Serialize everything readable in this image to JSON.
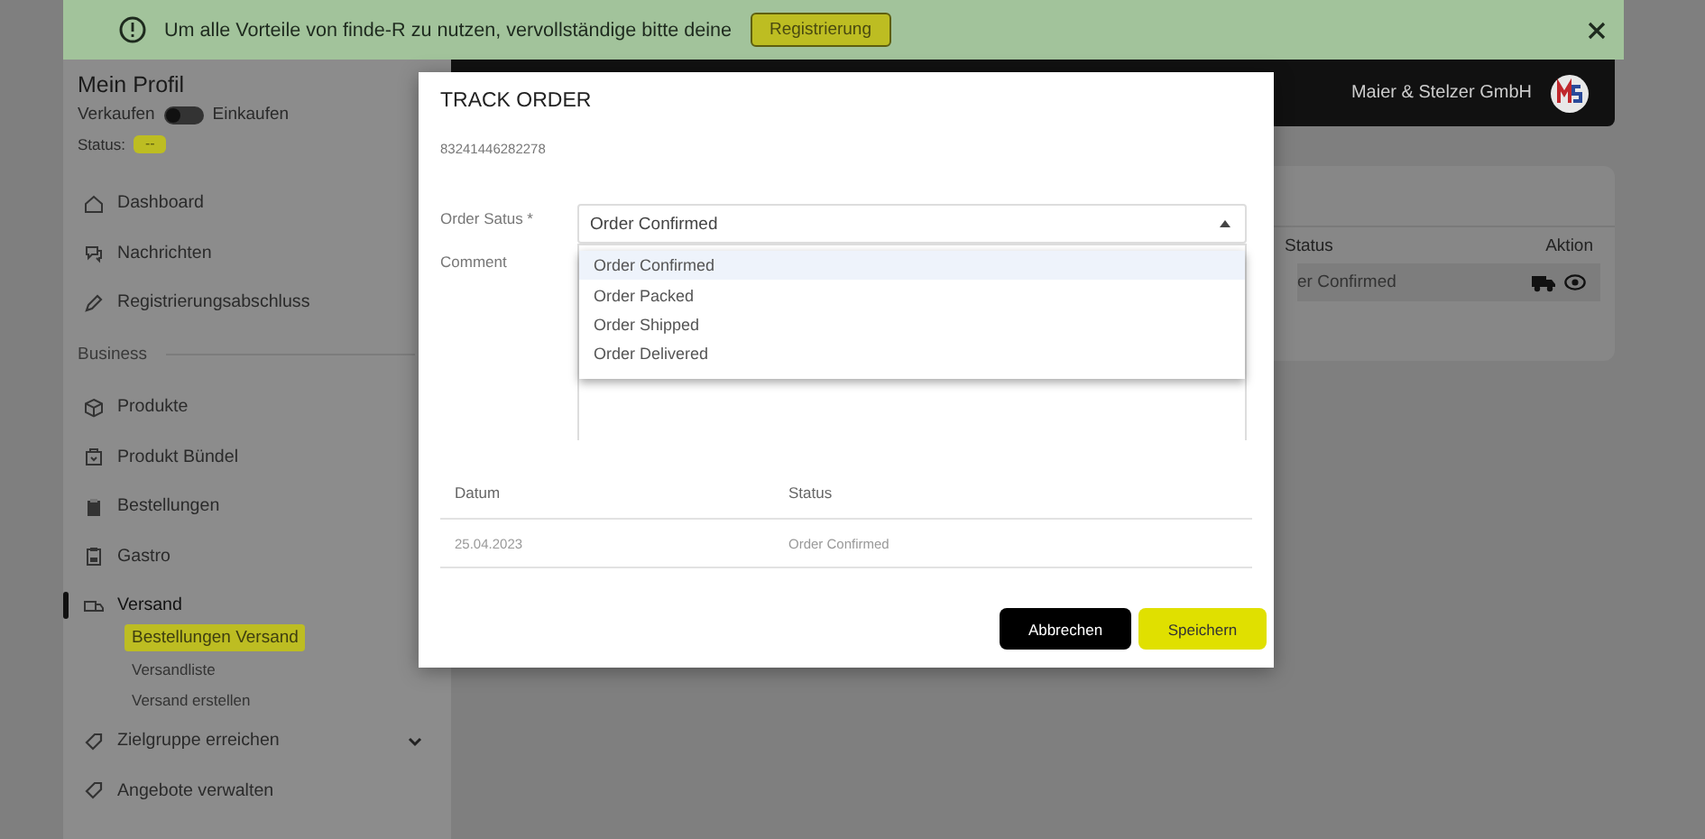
{
  "banner": {
    "message": "Um alle Vorteile von finde-R zu nutzen, vervollständige bitte deine",
    "button": "Registrierung"
  },
  "header": {
    "company": "Maier & Stelzer GmbH"
  },
  "sidebar": {
    "title": "Mein Profil",
    "mode_toggle": {
      "left_label": "Verkaufen",
      "right_label": "Einkaufen",
      "on": false
    },
    "status": {
      "label": "Status:",
      "badge": "--"
    },
    "items": [
      {
        "kind": "link",
        "label": "Dashboard",
        "selected": false
      },
      {
        "kind": "link",
        "label": "Nachrichten",
        "selected": false
      },
      {
        "kind": "link",
        "label": "Registrierungsabschluss",
        "selected": false
      },
      {
        "kind": "section",
        "label": "Business"
      },
      {
        "kind": "link",
        "label": "Produkte",
        "selected": false
      },
      {
        "kind": "link",
        "label": "Produkt Bündel",
        "selected": false
      },
      {
        "kind": "link",
        "label": "Bestellungen",
        "selected": false
      },
      {
        "kind": "link",
        "label": "Gastro",
        "selected": false
      },
      {
        "kind": "link",
        "label": "Versand",
        "selected": true,
        "children": [
          {
            "label": "Bestellungen Versand",
            "selected": true
          },
          {
            "label": "Versandliste",
            "selected": false
          },
          {
            "label": "Versand erstellen",
            "selected": false
          }
        ]
      },
      {
        "kind": "dropdown",
        "label": "Zielgruppe erreichen",
        "selected": false,
        "expanded": false
      },
      {
        "kind": "link",
        "label": "Angebote verwalten",
        "selected": false
      }
    ]
  },
  "orders_card": {
    "columns": [
      "Status",
      "Aktion"
    ],
    "rows": [
      {
        "status": "er Confirmed"
      }
    ]
  },
  "modal": {
    "title": "TRACK ORDER",
    "order_number": "83241446282278",
    "status_field": {
      "label": "Order Satus *",
      "value": "Order Confirmed",
      "open": true,
      "options": [
        {
          "label": "Order Confirmed",
          "selected": true
        },
        {
          "label": "Order Packed",
          "selected": false
        },
        {
          "label": "Order Shipped",
          "selected": false
        },
        {
          "label": "Order Delivered",
          "selected": false
        }
      ]
    },
    "comment_field": {
      "label": "Comment"
    },
    "history": {
      "columns": [
        "Datum",
        "Status"
      ],
      "rows": [
        [
          "25.04.2023",
          "Order Confirmed"
        ]
      ]
    },
    "buttons": [
      {
        "kind": "secondary",
        "label": "Abbrechen"
      },
      {
        "kind": "primary",
        "label": "Speichern"
      }
    ]
  }
}
